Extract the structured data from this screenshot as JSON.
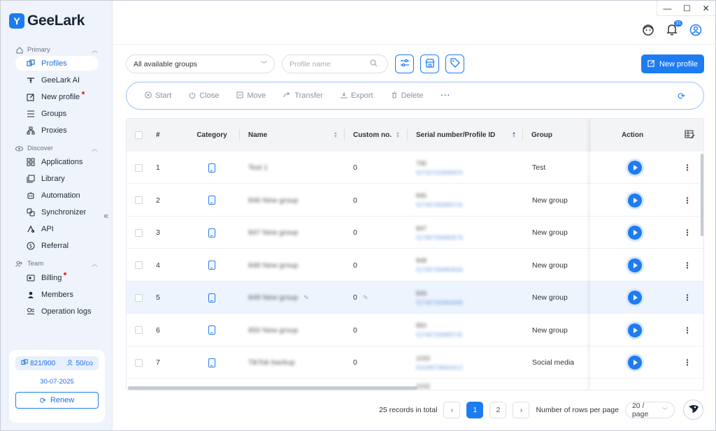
{
  "app": {
    "logo_mark": "Y",
    "name": "GeeLark"
  },
  "window_controls": {
    "minimize": "—",
    "maximize": "☐",
    "close": "✕"
  },
  "header": {
    "notification_count": "31"
  },
  "sidebar": {
    "sections": [
      {
        "label": "Primary",
        "icon": "home-icon"
      },
      {
        "label": "Discover",
        "icon": "eye-icon"
      },
      {
        "label": "Team",
        "icon": "team-icon"
      }
    ],
    "items": [
      {
        "label": "Profiles",
        "icon": "profiles-icon",
        "active": true
      },
      {
        "label": "GeeLark AI",
        "icon": "ai-icon"
      },
      {
        "label": "New profile",
        "icon": "edit-icon",
        "dot": true
      },
      {
        "label": "Groups",
        "icon": "list-icon"
      },
      {
        "label": "Proxies",
        "icon": "network-icon"
      },
      {
        "label": "Applications",
        "icon": "grid-icon"
      },
      {
        "label": "Library",
        "icon": "library-icon"
      },
      {
        "label": "Automation",
        "icon": "robot-icon"
      },
      {
        "label": "Synchronizer",
        "icon": "sync-icon"
      },
      {
        "label": "API",
        "icon": "api-icon"
      },
      {
        "label": "Referral",
        "icon": "dollar-icon"
      },
      {
        "label": "Billing",
        "icon": "billing-icon",
        "dot": true
      },
      {
        "label": "Members",
        "icon": "person-icon"
      },
      {
        "label": "Operation logs",
        "icon": "logs-icon"
      }
    ],
    "plan": {
      "profiles": "821/900",
      "members": "50/co",
      "date": "30-07-2025",
      "renew_label": "Renew"
    }
  },
  "filters": {
    "group_select": "All available groups",
    "search_placeholder": "Profile name",
    "new_profile_label": "New profile"
  },
  "toolbar": {
    "start": "Start",
    "close": "Close",
    "move": "Move",
    "transfer": "Transfer",
    "export": "Export",
    "delete": "Delete",
    "more": "···"
  },
  "table": {
    "columns": [
      "#",
      "Category",
      "Name",
      "Custom no.",
      "Serial number/Profile ID",
      "Group",
      "Action"
    ],
    "rows": [
      {
        "num": "1",
        "name": "Test 1",
        "custom": "0",
        "serial": "796",
        "profile_id": "527207323080970",
        "group": "Test"
      },
      {
        "num": "2",
        "name": "846 New group",
        "custom": "0",
        "serial": "846",
        "profile_id": "527497260893716",
        "group": "New group"
      },
      {
        "num": "3",
        "name": "847 New group",
        "custom": "0",
        "serial": "847",
        "profile_id": "527497260893579",
        "group": "New group"
      },
      {
        "num": "4",
        "name": "848 New group",
        "custom": "0",
        "serial": "848",
        "profile_id": "527497260893633",
        "group": "New group"
      },
      {
        "num": "5",
        "name": "849 New group",
        "custom": "0",
        "serial": "849",
        "profile_id": "527497260893689",
        "group": "New group"
      },
      {
        "num": "6",
        "name": "850 New group",
        "custom": "0",
        "serial": "850",
        "profile_id": "527497260893745",
        "group": "New group"
      },
      {
        "num": "7",
        "name": "TikTok backup",
        "custom": "0",
        "serial": "1033",
        "profile_id": "531069798064512",
        "group": "Social media"
      }
    ],
    "partial_row_serial": "1015"
  },
  "pagination": {
    "total": "25 records in total",
    "prev": "‹",
    "next": "›",
    "pages": [
      "1",
      "2"
    ],
    "rows_label": "Number of rows per page",
    "page_size": "20 / page"
  },
  "colors": {
    "accent": "#1e7cf2",
    "sidebar_bg": "#eef3fc",
    "highlight_row": "#edf4fd"
  }
}
